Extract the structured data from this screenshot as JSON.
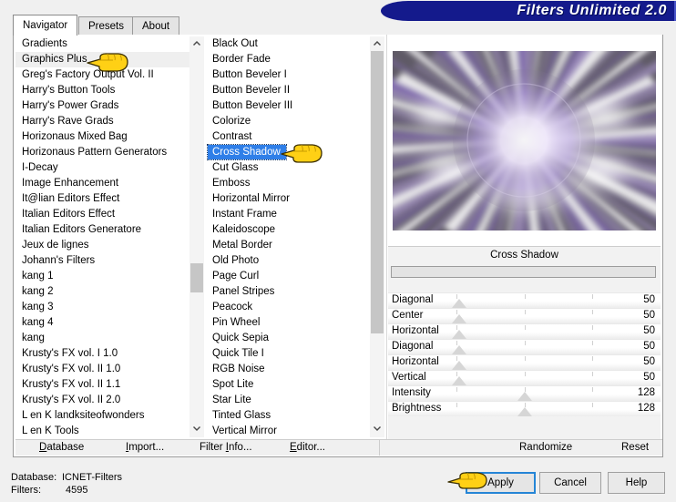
{
  "window": {
    "banner_title": "Filters Unlimited 2.0"
  },
  "tabs": [
    {
      "label": "Navigator",
      "active": true
    },
    {
      "label": "Presets",
      "active": false
    },
    {
      "label": "About",
      "active": false
    }
  ],
  "categories": {
    "items": [
      "Gradients",
      "Graphics Plus",
      "Greg's Factory Output Vol. II",
      "Harry's Button Tools",
      "Harry's Power Grads",
      "Harry's Rave Grads",
      "Horizonaus Mixed Bag",
      "Horizonaus Pattern Generators",
      "I-Decay",
      "Image Enhancement",
      "It@lian Editors Effect",
      "Italian Editors Effect",
      "Italian Editors Generatore",
      "Jeux de lignes",
      "Johann's Filters",
      "kang 1",
      "kang 2",
      "kang 3",
      "kang 4",
      "kang",
      "Krusty's FX vol. I 1.0",
      "Krusty's FX vol. II 1.0",
      "Krusty's FX vol. II 1.1",
      "Krusty's FX vol. II 2.0",
      "L en K landksiteofwonders",
      "L en K Tools"
    ],
    "highlighted": "Graphics Plus",
    "scroll_thumb_top_pct": 57,
    "scroll_thumb_height_pct": 8
  },
  "filters": {
    "items": [
      "Black Out",
      "Border Fade",
      "Button Beveler I",
      "Button Beveler II",
      "Button Beveler III",
      "Colorize",
      "Contrast",
      "Cross Shadow",
      "Cut Glass",
      "Emboss",
      "Horizontal Mirror",
      "Instant Frame",
      "Kaleidoscope",
      "Metal Border",
      "Old Photo",
      "Page Curl",
      "Panel Stripes",
      "Peacock",
      "Pin Wheel",
      "Quick Sepia",
      "Quick Tile I",
      "RGB Noise",
      "Spot Lite",
      "Star Lite",
      "Tinted Glass",
      "Vertical Mirror"
    ],
    "selected": "Cross Shadow",
    "selected_index": 7,
    "scroll_thumb_top_pct": 0,
    "scroll_thumb_height_pct": 76
  },
  "parameters": {
    "title": "Cross Shadow",
    "rows": [
      {
        "label": "Diagonal",
        "value": "50",
        "thumb_pct": 26
      },
      {
        "label": "Center",
        "value": "50",
        "thumb_pct": 26
      },
      {
        "label": "Horizontal",
        "value": "50",
        "thumb_pct": 26
      },
      {
        "label": "Diagonal",
        "value": "50",
        "thumb_pct": 26
      },
      {
        "label": "Horizontal",
        "value": "50",
        "thumb_pct": 26
      },
      {
        "label": "Vertical",
        "value": "50",
        "thumb_pct": 26
      },
      {
        "label": "Intensity",
        "value": "128",
        "thumb_pct": 50
      },
      {
        "label": "Brightness",
        "value": "128",
        "thumb_pct": 50
      }
    ]
  },
  "commandbar": {
    "database": "Database",
    "import": "Import...",
    "filter_info": "Filter Info...",
    "editor": "Editor...",
    "randomize": "Randomize",
    "reset": "Reset"
  },
  "status": {
    "database_label": "Database:",
    "database_value": "ICNET-Filters",
    "filters_label": "Filters:",
    "filters_value": "4595"
  },
  "buttons": {
    "apply": "Apply",
    "cancel": "Cancel",
    "help": "Help"
  },
  "colors": {
    "banner_blue": "#141a8c",
    "selection_blue": "#2f7fe8",
    "default_button_outline": "#2585d6",
    "hand_yellow": "#ffd015",
    "preview_purple": "#9b7fd4"
  }
}
